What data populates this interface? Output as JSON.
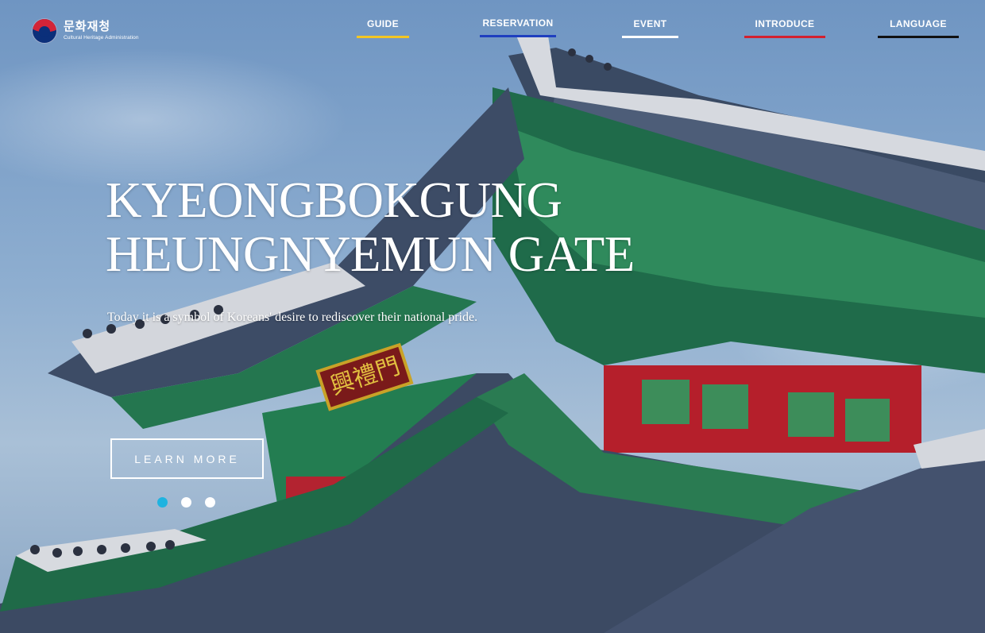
{
  "logo": {
    "korean": "문화재청",
    "english": "Cultural Heritage Administration"
  },
  "nav": [
    {
      "label": "GUIDE",
      "bar_color": "#f3c623"
    },
    {
      "label": "RESERVATION",
      "bar_color": "#1f3fbf"
    },
    {
      "label": "EVENT",
      "bar_color": "#ffffff"
    },
    {
      "label": "INTRODUCE",
      "bar_color": "#d3202f"
    },
    {
      "label": "LANGUAGE",
      "bar_color": "#111111"
    }
  ],
  "hero": {
    "title_line1": "KYEONGBOKGUNG",
    "title_line2": "HEUNGNYEMUN GATE",
    "subtitle": "Today it is a symbol of Koreans' desire to rediscover their national pride.",
    "cta_label": "LEARN MORE",
    "signboard": "興禮門"
  },
  "slider": {
    "active_index": 0,
    "count": 3,
    "active_color": "#1fb3e0"
  }
}
